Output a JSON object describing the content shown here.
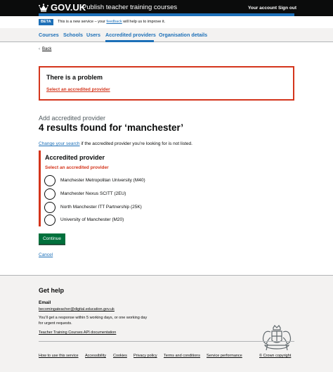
{
  "header": {
    "logo": "GOV.UK",
    "service_name": "Publish teacher training courses",
    "links": [
      "Your account",
      "Sign out"
    ]
  },
  "phase_banner": {
    "tag": "BETA",
    "text_before": "This is a new service – your ",
    "link": "feedback",
    "text_after": " will help us to improve it."
  },
  "nav": {
    "items": [
      "Courses",
      "Schools",
      "Users",
      "Accredited providers",
      "Organisation details"
    ],
    "active": "Accredited providers"
  },
  "back_link": "Back",
  "error_summary": {
    "title": "There is a problem",
    "link": "Select an accredited provider"
  },
  "page": {
    "caption": "Add accredited provider",
    "heading": "4 results found for ‘manchester’",
    "change_link": "Change your search",
    "change_text": " if the accredited provider you’re looking for is not listed."
  },
  "form": {
    "legend": "Accredited provider",
    "error": "Select an accredited provider",
    "options": [
      "Manchester Metropolitan University (M40)",
      "Manchester Nexus SCITT (2EU)",
      "North Manchester ITT Partnership (25K)",
      "University of Manchester (M20)"
    ],
    "continue": "Continue",
    "cancel": "Cancel"
  },
  "footer": {
    "help_title": "Get help",
    "email_heading": "Email",
    "email": "becomingateacher@digital.education.gov.uk",
    "response": "You’ll get a response within 5 working days, or one working day for urgent requests.",
    "api_link": "Teacher Training Courses API documentation",
    "links": [
      "How to use this service",
      "Accessibility",
      "Cookies",
      "Privacy policy",
      "Terms and conditions",
      "Service performance"
    ],
    "copyright": "© Crown copyright"
  },
  "colors": {
    "header": "#0b0c0c",
    "link": "#1d70b8",
    "error": "#d4351c",
    "button": "#00703c",
    "footer": "#f3f2f1"
  }
}
